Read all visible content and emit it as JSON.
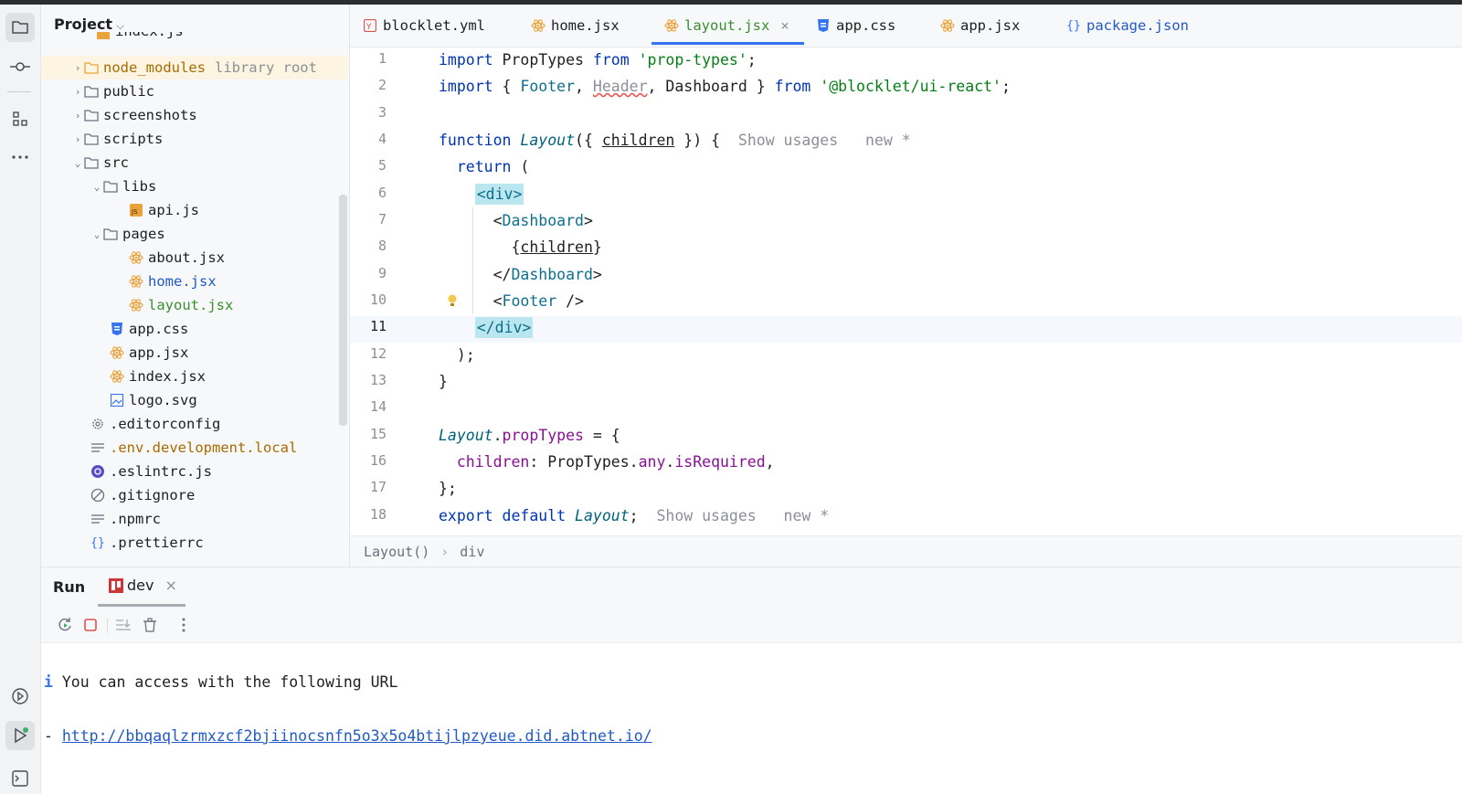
{
  "project": {
    "title": "Project",
    "partial_item": "index.js",
    "items": [
      {
        "name": "node_modules",
        "suffix": "library root",
        "kind": "folder"
      },
      {
        "name": "public",
        "kind": "folder"
      },
      {
        "name": "screenshots",
        "kind": "folder"
      },
      {
        "name": "scripts",
        "kind": "folder"
      },
      {
        "name": "src",
        "kind": "folder"
      },
      {
        "name": "libs",
        "kind": "folder"
      },
      {
        "name": "api.js",
        "kind": "js"
      },
      {
        "name": "pages",
        "kind": "folder"
      },
      {
        "name": "about.jsx",
        "kind": "react"
      },
      {
        "name": "home.jsx",
        "kind": "react"
      },
      {
        "name": "layout.jsx",
        "kind": "react"
      },
      {
        "name": "app.css",
        "kind": "css"
      },
      {
        "name": "app.jsx",
        "kind": "react"
      },
      {
        "name": "index.jsx",
        "kind": "react"
      },
      {
        "name": "logo.svg",
        "kind": "image"
      },
      {
        "name": ".editorconfig",
        "kind": "gear"
      },
      {
        "name": ".env.development.local",
        "kind": "text"
      },
      {
        "name": ".eslintrc.js",
        "kind": "eslint"
      },
      {
        "name": ".gitignore",
        "kind": "ignore"
      },
      {
        "name": ".npmrc",
        "kind": "text"
      },
      {
        "name": ".prettierrc",
        "kind": "json"
      }
    ]
  },
  "tabs": [
    {
      "label": "blocklet.yml"
    },
    {
      "label": "home.jsx"
    },
    {
      "label": "layout.jsx",
      "close": "×"
    },
    {
      "label": "app.css"
    },
    {
      "label": "app.jsx"
    },
    {
      "label": "package.json"
    }
  ],
  "editor": {
    "line_numbers": [
      "1",
      "2",
      "3",
      "4",
      "5",
      "6",
      "7",
      "8",
      "9",
      "10",
      "11",
      "12",
      "13",
      "14",
      "15",
      "16",
      "17",
      "18"
    ],
    "code": {
      "l1_import": "import",
      "l1_name": "PropTypes",
      "l1_from": "from",
      "l1_str": "'prop-types'",
      "l1_semi": ";",
      "l2_import": "import",
      "l2_open": "{",
      "l2_footer": "Footer",
      "l2_comma1": ",",
      "l2_header": "Header",
      "l2_comma2": ",",
      "l2_dashboard": "Dashboard",
      "l2_close": "}",
      "l2_from": "from",
      "l2_str": "'@blocklet/ui-react'",
      "l2_semi": ";",
      "l4_function": "function",
      "l4_name": "Layout",
      "l4_open": "({",
      "l4_children": "children",
      "l4_close": "}) {",
      "l4_hint": "Show usages",
      "l4_new": "new *",
      "l5_return": "return",
      "l5_paren": "(",
      "l6_div": "<div>",
      "l7_lt": "<",
      "l7_tag": "Dashboard",
      "l7_gt": ">",
      "l8_open": "{",
      "l8_children": "children",
      "l8_close": "}",
      "l9_lt": "</",
      "l9_tag": "Dashboard",
      "l9_gt": ">",
      "l10_lt": "<",
      "l10_tag": "Footer",
      "l10_gt": " />",
      "l11_div": "</div>",
      "l12_text": ");",
      "l13_text": "}",
      "l15_name": "Layout",
      "l15_dot": ".",
      "l15_prop": "propTypes",
      "l15_eq": " = {",
      "l16_key": "children",
      "l16_colon": ": ",
      "l16_pt": "PropTypes",
      "l16_dot1": ".",
      "l16_any": "any",
      "l16_dot2": ".",
      "l16_req": "isRequired",
      "l16_comma": ",",
      "l17_text": "};",
      "l18_export": "export",
      "l18_default": "default",
      "l18_name": "Layout",
      "l18_semi": ";",
      "l18_hint": "Show usages",
      "l18_new": "new *"
    }
  },
  "breadcrumb": {
    "items": [
      "Layout()",
      "div"
    ],
    "separator": "›"
  },
  "run": {
    "title": "Run",
    "tab_label": "dev",
    "tab_close": "×",
    "console": {
      "info_marker": "i",
      "message": "You can access with the following URL",
      "dash": "-",
      "url": "http://bbqaqlzrmxzcf2bjiinocsnfn5o3x5o4btijlpzyeue.did.abtnet.io/"
    }
  },
  "colors": {
    "accent": "#3574f0",
    "keyword": "#0033b3",
    "string": "#067d17",
    "react": "#e8a33d",
    "highlight": "#fdf5e2"
  }
}
